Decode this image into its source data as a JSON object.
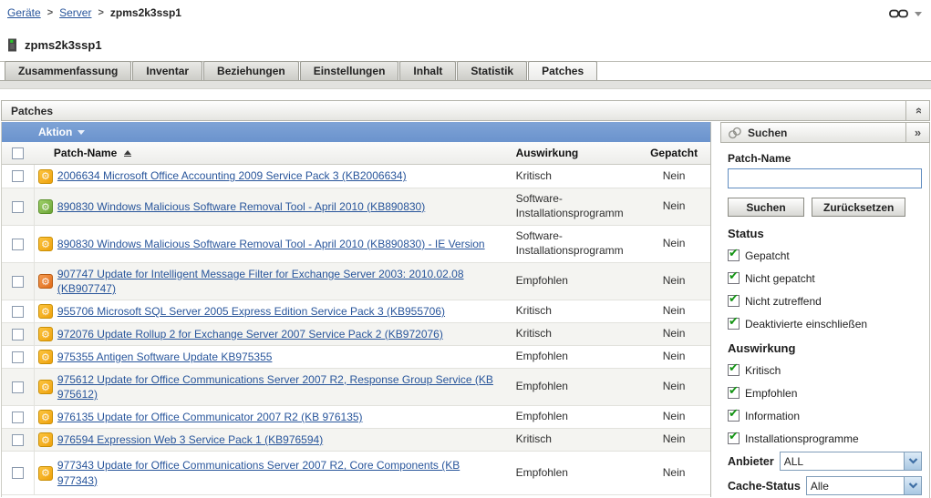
{
  "breadcrumb": {
    "items": [
      {
        "label": "Geräte"
      },
      {
        "label": "Server"
      },
      {
        "label": "zpms2k3ssp1"
      }
    ]
  },
  "device": {
    "name": "zpms2k3ssp1"
  },
  "tabs": {
    "items": [
      {
        "label": "Zusammenfassung",
        "active": false
      },
      {
        "label": "Inventar",
        "active": false
      },
      {
        "label": "Beziehungen",
        "active": false
      },
      {
        "label": "Einstellungen",
        "active": false
      },
      {
        "label": "Inhalt",
        "active": false
      },
      {
        "label": "Statistik",
        "active": false
      },
      {
        "label": "Patches",
        "active": true
      }
    ]
  },
  "patches_panel": {
    "title": "Patches"
  },
  "action_bar": {
    "label": "Aktion"
  },
  "table": {
    "headers": {
      "patch_name": "Patch-Name",
      "impact": "Auswirkung",
      "patched": "Gepatcht"
    },
    "sort": {
      "column": "Patch-Name",
      "direction": "ascending"
    },
    "rows": [
      {
        "name": "2006634 Microsoft Office Accounting 2009 Service Pack 3 (KB2006634)",
        "impact": "Kritisch",
        "patched": "Nein",
        "icon": "yellow"
      },
      {
        "name": "890830 Windows Malicious Software Removal Tool - April 2010 (KB890830)",
        "impact": "Software-Installationsprogramm",
        "patched": "Nein",
        "icon": "green"
      },
      {
        "name": "890830 Windows Malicious Software Removal Tool - April 2010 (KB890830) - IE Version",
        "impact": "Software-Installationsprogramm",
        "patched": "Nein",
        "icon": "yellow"
      },
      {
        "name": "907747 Update for Intelligent Message Filter for Exchange Server 2003: 2010.02.08 (KB907747)",
        "impact": "Empfohlen",
        "patched": "Nein",
        "icon": "orange"
      },
      {
        "name": "955706 Microsoft SQL Server 2005 Express Edition Service Pack 3 (KB955706)",
        "impact": "Kritisch",
        "patched": "Nein",
        "icon": "yellow"
      },
      {
        "name": "972076 Update Rollup 2 for Exchange Server 2007 Service Pack 2 (KB972076)",
        "impact": "Kritisch",
        "patched": "Nein",
        "icon": "yellow"
      },
      {
        "name": "975355 Antigen Software Update KB975355",
        "impact": "Empfohlen",
        "patched": "Nein",
        "icon": "yellow"
      },
      {
        "name": "975612 Update for Office Communications Server 2007 R2, Response Group Service (KB 975612)",
        "impact": "Empfohlen",
        "patched": "Nein",
        "icon": "yellow"
      },
      {
        "name": "976135 Update for Office Communicator 2007 R2 (KB 976135)",
        "impact": "Empfohlen",
        "patched": "Nein",
        "icon": "yellow"
      },
      {
        "name": "976594 Expression Web 3 Service Pack 1 (KB976594)",
        "impact": "Kritisch",
        "patched": "Nein",
        "icon": "yellow"
      },
      {
        "name": "977343 Update for Office Communications Server 2007 R2, Core Components (KB 977343)",
        "impact": "Empfohlen",
        "patched": "Nein",
        "icon": "yellow"
      }
    ]
  },
  "search": {
    "title": "Suchen",
    "patch_name_label": "Patch-Name",
    "patch_name_value": "",
    "search_button": "Suchen",
    "reset_button": "Zurücksetzen",
    "status_heading": "Status",
    "status_options": [
      {
        "label": "Gepatcht",
        "checked": true
      },
      {
        "label": "Nicht gepatcht",
        "checked": true
      },
      {
        "label": "Nicht zutreffend",
        "checked": true
      },
      {
        "label": "Deaktivierte einschließen",
        "checked": true
      }
    ],
    "impact_heading": "Auswirkung",
    "impact_options": [
      {
        "label": "Kritisch",
        "checked": true
      },
      {
        "label": "Empfohlen",
        "checked": true
      },
      {
        "label": "Information",
        "checked": true
      },
      {
        "label": "Installationsprogramme",
        "checked": true
      }
    ],
    "vendor_label": "Anbieter",
    "vendor_value": "ALL",
    "cache_label": "Cache-Status",
    "cache_value": "Alle"
  },
  "colors": {
    "action_bar_blue": "#6b93cd",
    "link_blue": "#28559b",
    "check_green": "#149414",
    "icon_yellow": "#eea10c",
    "icon_green": "#6ba434",
    "icon_orange": "#e06c1a"
  }
}
